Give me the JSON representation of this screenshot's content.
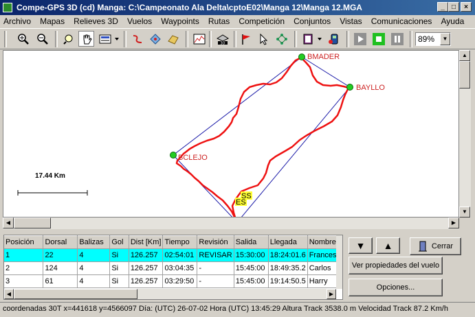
{
  "window": {
    "title": "Compe-GPS 3D  (cd)  Manga: C:\\Campeonato Ala Delta\\cptoE02\\Manga 12\\Manga 12.MGA",
    "minimize": "_",
    "maximize": "□",
    "close": "×"
  },
  "menu": [
    "Archivo",
    "Mapas",
    "Relieves 3D",
    "Vuelos",
    "Waypoints",
    "Rutas",
    "Competición",
    "Conjuntos",
    "Vistas",
    "Comunicaciones",
    "Ayuda"
  ],
  "toolbar": {
    "zoom_value": "89%",
    "icons": [
      "zoom-in-icon",
      "zoom-out-icon",
      "zoom-tool-icon",
      "hand-pan-icon",
      "map-view-icon",
      "draw-track-icon",
      "waypoints-icon",
      "map-3d-icon",
      "profile-chart-icon",
      "3d-view-icon",
      "flag-icon",
      "cursor-icon",
      "network-icon",
      "book-icon",
      "gps-icon",
      "play-icon",
      "stop-icon",
      "pause-icon"
    ]
  },
  "map": {
    "scale_label": "17.44 Km",
    "waypoints": [
      {
        "name": "BMADER"
      },
      {
        "name": "BAYLLO"
      },
      {
        "name": "BCLEJO"
      }
    ],
    "start_labels": [
      "ES",
      "SS"
    ],
    "colors": {
      "track": "#ee1111",
      "route": "#1a1aa8",
      "waypoint": "#22cc22",
      "label": "#cc2222"
    }
  },
  "results": {
    "columns": [
      "Posición",
      "Dorsal",
      "Balizas",
      "Gol",
      "Dist [Km]",
      "Tiempo",
      "Revisión",
      "Salida",
      "Llegada",
      "Nombre"
    ],
    "rows": [
      [
        "1",
        "22",
        "4",
        "Si",
        "126.257",
        "02:54:01",
        "REVISAR",
        "15:30:00",
        "18:24:01.6",
        "Francesc"
      ],
      [
        "2",
        "124",
        "4",
        "Si",
        "126.257",
        "03:04:35",
        "-",
        "15:45:00",
        "18:49:35.2",
        "Carlos"
      ],
      [
        "3",
        "61",
        "4",
        "Si",
        "126.257",
        "03:29:50",
        "-",
        "15:45:00",
        "19:14:50.5",
        "Harry"
      ]
    ]
  },
  "buttons": {
    "down": "▼",
    "up": "▲",
    "close": "Cerrar",
    "properties": "Ver propiedades del vuelo",
    "options": "Opciones..."
  },
  "status": {
    "text": "coordenadas 30T   x=441618  y=4566097 Día: (UTC) 26-07-02 Hora (UTC) 13:45:29 Altura Track 3538.0 m Velocidad Track 87.2 Km/h"
  }
}
